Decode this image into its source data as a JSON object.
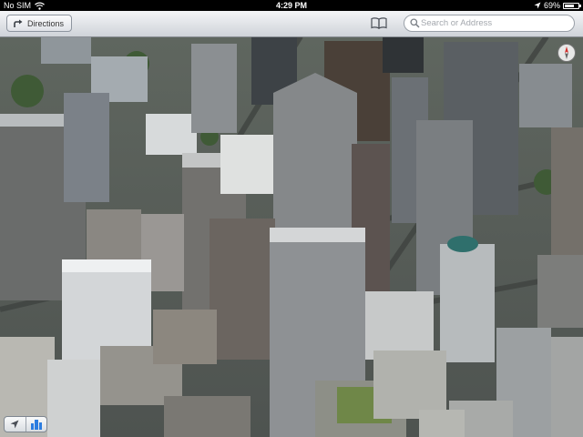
{
  "status_bar": {
    "carrier": "No SIM",
    "time": "4:29 PM",
    "battery_text": "69%",
    "battery_level": 0.69,
    "icons": [
      "wifi-icon",
      "location-arrow-icon",
      "battery-icon"
    ]
  },
  "nav_bar": {
    "directions_label": "Directions",
    "directions_icon": "turn-arrow-icon",
    "bookmarks_icon": "book-icon",
    "search_placeholder": "Search or Address",
    "search_value": "",
    "search_icon": "magnifier-icon"
  },
  "map": {
    "view": "3D satellite flyover",
    "compass_icon": "compass-icon"
  },
  "bottom_controls": {
    "location_icon": "location-arrow-icon",
    "view_mode_icon": "3d-buildings-icon",
    "accent": "#2c7de0"
  }
}
